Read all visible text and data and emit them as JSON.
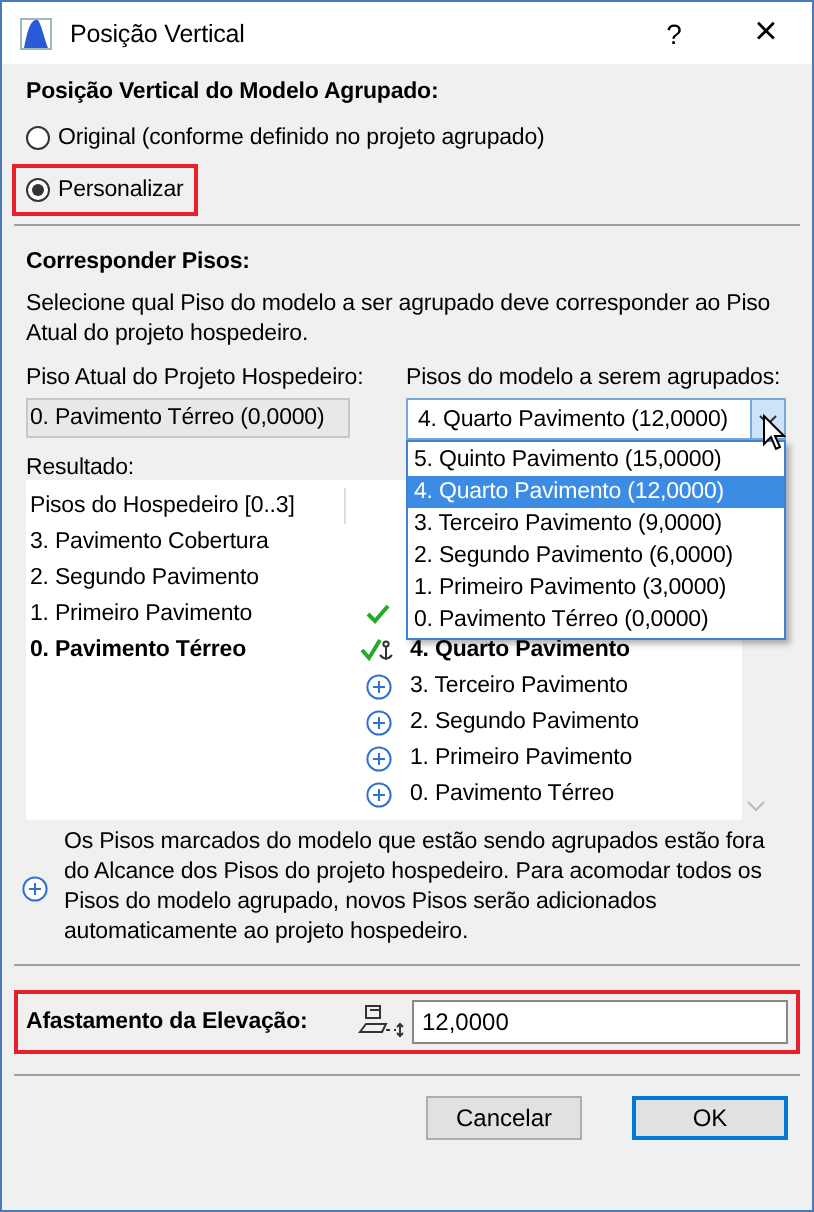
{
  "window": {
    "title": "Posição Vertical",
    "help": "?",
    "close": "×"
  },
  "position": {
    "heading": "Posição Vertical do Modelo Agrupado:",
    "options": [
      {
        "label": "Original (conforme definido no projeto agrupado)",
        "selected": false,
        "highlighted": false
      },
      {
        "label": "Personalizar",
        "selected": true,
        "highlighted": true
      }
    ]
  },
  "match": {
    "heading": "Corresponder Pisos:",
    "description": "Selecione qual Piso do modelo a ser agrupado deve corresponder ao Piso Atual do projeto hospedeiro.",
    "host_label": "Piso Atual do Projeto Hospedeiro:",
    "host_value": "0. Pavimento Térreo (0,0000)",
    "model_label": "Pisos do modelo a serem agrupados:",
    "model_value": "4. Quarto Pavimento (12,0000)",
    "dropdown": [
      {
        "label": "5. Quinto Pavimento (15,0000)",
        "selected": false
      },
      {
        "label": "4. Quarto Pavimento (12,0000)",
        "selected": true
      },
      {
        "label": "3. Terceiro Pavimento (9,0000)",
        "selected": false
      },
      {
        "label": "2. Segundo Pavimento (6,0000)",
        "selected": false
      },
      {
        "label": "1. Primeiro Pavimento (3,0000)",
        "selected": false
      },
      {
        "label": "0. Pavimento Térreo (0,0000)",
        "selected": false
      }
    ]
  },
  "result": {
    "label": "Resultado:",
    "host_header": "Pisos do Hospedeiro [0..3]",
    "rows": [
      {
        "host": "3. Pavimento Cobertura",
        "bold": false
      },
      {
        "host": "2. Segundo Pavimento",
        "bold": false
      },
      {
        "host": "1. Primeiro Pavimento",
        "kind": "check",
        "bold": false
      },
      {
        "host": "0. Pavimento Térreo",
        "kind": "anchor",
        "model": "4. Quarto Pavimento",
        "bold": true
      },
      {
        "kind": "add",
        "model": "3. Terceiro Pavimento",
        "bold": false
      },
      {
        "kind": "add",
        "model": "2. Segundo Pavimento",
        "bold": false
      },
      {
        "kind": "add",
        "model": "1. Primeiro Pavimento",
        "bold": false
      },
      {
        "kind": "add",
        "model": "0. Pavimento Térreo",
        "bold": false
      }
    ]
  },
  "note": "Os Pisos marcados do modelo que estão sendo agrupados estão fora do Alcance dos Pisos do projeto hospedeiro. Para acomodar todos os Pisos do modelo agrupado, novos Pisos serão adicionados automaticamente ao projeto hospedeiro.",
  "offset": {
    "label": "Afastamento da Elevação:",
    "value": "12,0000",
    "highlighted": true
  },
  "buttons": [
    {
      "label": "Cancelar",
      "default": false
    },
    {
      "label": "OK",
      "default": true
    }
  ]
}
